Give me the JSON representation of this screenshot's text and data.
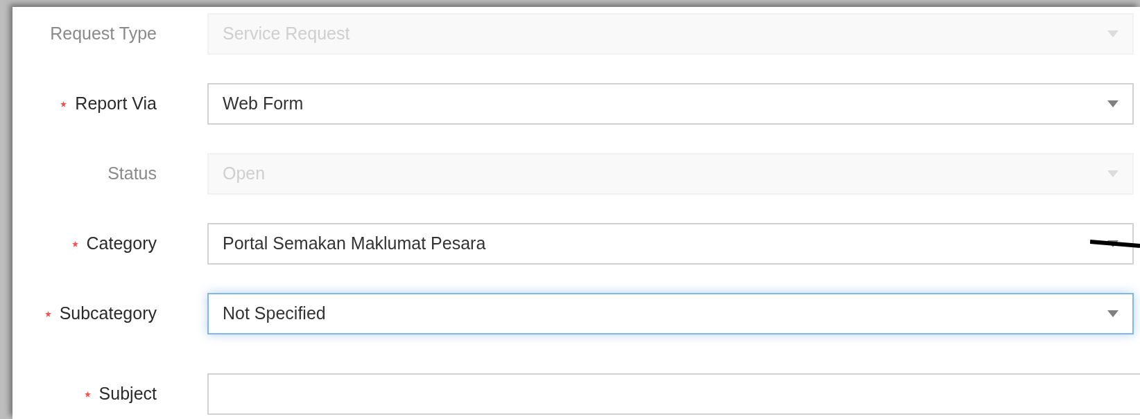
{
  "fields": [
    {
      "label": "Request Type",
      "required": false,
      "kind": "select",
      "value": "Service Request",
      "disabled": true,
      "focused": false
    },
    {
      "label": "Report Via",
      "required": true,
      "kind": "select",
      "value": "Web Form",
      "disabled": false,
      "focused": false
    },
    {
      "label": "Status",
      "required": false,
      "kind": "select",
      "value": "Open",
      "disabled": true,
      "focused": false
    },
    {
      "label": "Category",
      "required": true,
      "kind": "select",
      "value": "Portal Semakan Maklumat Pesara",
      "disabled": false,
      "focused": false
    },
    {
      "label": "Subcategory",
      "required": true,
      "kind": "select",
      "value": "Not Specified",
      "disabled": false,
      "focused": true
    },
    {
      "label": "Subject",
      "required": true,
      "kind": "text",
      "disabled": false,
      "focused": false
    }
  ]
}
